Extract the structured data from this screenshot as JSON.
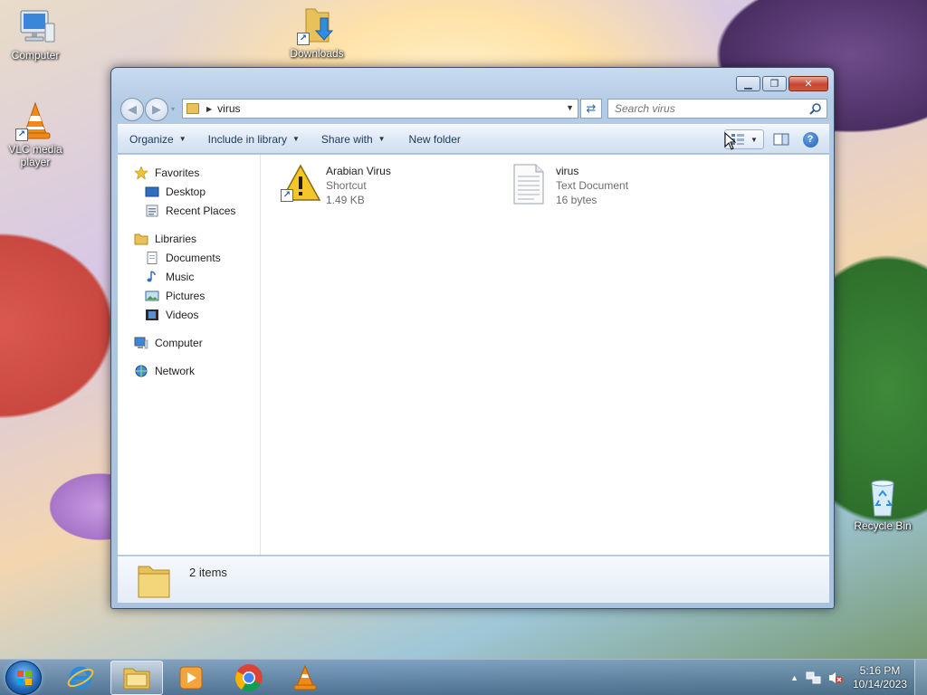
{
  "desktop": {
    "icons": [
      {
        "label": "Computer"
      },
      {
        "label": "Downloads"
      },
      {
        "label": "VLC media player"
      },
      {
        "label": "Recycle Bin"
      }
    ]
  },
  "window": {
    "address": {
      "path": "virus"
    },
    "search": {
      "placeholder": "Search virus"
    },
    "toolbar": {
      "organize": "Organize",
      "include_in_library": "Include in library",
      "share_with": "Share with",
      "new_folder": "New folder"
    },
    "nav": {
      "favorites": {
        "label": "Favorites",
        "items": [
          "Desktop",
          "Recent Places"
        ]
      },
      "libraries": {
        "label": "Libraries",
        "items": [
          "Documents",
          "Music",
          "Pictures",
          "Videos"
        ]
      },
      "computer": "Computer",
      "network": "Network"
    },
    "files": [
      {
        "name": "Arabian Virus",
        "type": "Shortcut",
        "size": "1.49 KB",
        "icon": "warning-shortcut-icon"
      },
      {
        "name": "virus",
        "type": "Text Document",
        "size": "16 bytes",
        "icon": "text-document-icon"
      }
    ],
    "status": {
      "item_count": "2 items"
    }
  },
  "taskbar": {
    "pinned": [
      "internet-explorer-icon",
      "windows-explorer-icon",
      "windows-media-player-icon",
      "chrome-icon",
      "vlc-icon"
    ],
    "active": "windows-explorer-icon",
    "clock": {
      "time": "5:16 PM",
      "date": "10/14/2023"
    }
  }
}
